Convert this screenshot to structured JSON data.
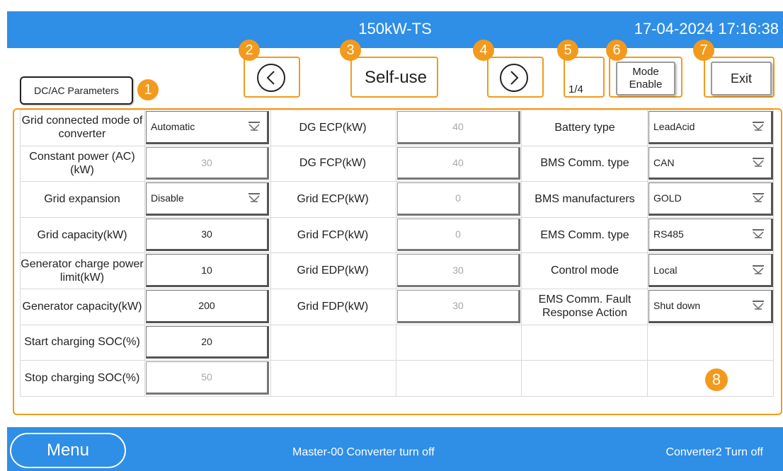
{
  "header": {
    "title": "150kW-TS",
    "datetime": "17-04-2024 17:16:38"
  },
  "toolbar": {
    "dcac_label": "DC/AC Parameters",
    "mode_label": "Self-use",
    "page": "1/4",
    "mode_enable_line1": "Mode",
    "mode_enable_line2": "Enable",
    "exit_label": "Exit"
  },
  "badges": [
    "1",
    "2",
    "3",
    "4",
    "5",
    "6",
    "7",
    "8"
  ],
  "colors": {
    "header": "#2f8ee6",
    "accent": "#f29a1d"
  },
  "col1": [
    {
      "label": "Grid connected mode of converter",
      "value": "Automatic",
      "kind": "select"
    },
    {
      "label": "Constant power (AC)(kW)",
      "value": "30",
      "kind": "dim"
    },
    {
      "label": "Grid expansion",
      "value": "Disable",
      "kind": "select"
    },
    {
      "label": "Grid capacity(kW)",
      "value": "30",
      "kind": "dark"
    },
    {
      "label": "Generator charge power limit(kW)",
      "value": "10",
      "kind": "dark"
    },
    {
      "label": "Generator capacity(kW)",
      "value": "200",
      "kind": "dark"
    },
    {
      "label": "Start charging SOC(%)",
      "value": "20",
      "kind": "dark"
    },
    {
      "label": "Stop charging SOC(%)",
      "value": "50",
      "kind": "dim"
    }
  ],
  "col2": [
    {
      "label": "DG ECP(kW)",
      "value": "40"
    },
    {
      "label": "DG FCP(kW)",
      "value": "40"
    },
    {
      "label": "Grid ECP(kW)",
      "value": "0"
    },
    {
      "label": "Grid FCP(kW)",
      "value": "0"
    },
    {
      "label": "Grid EDP(kW)",
      "value": "30"
    },
    {
      "label": "Grid FDP(kW)",
      "value": "30"
    }
  ],
  "col3": [
    {
      "label": "Battery type",
      "value": "LeadAcid"
    },
    {
      "label": "BMS Comm. type",
      "value": "CAN"
    },
    {
      "label": "BMS manufacturers",
      "value": "GOLD"
    },
    {
      "label": "EMS Comm. type",
      "value": "RS485"
    },
    {
      "label": "Control mode",
      "value": "Local"
    },
    {
      "label": "EMS Comm. Fault Response Action",
      "value": "Shut down"
    }
  ],
  "footer": {
    "menu_label": "Menu",
    "status_message": "Master-00 Converter turn off",
    "converter2_status": "Converter2 Turn off"
  }
}
